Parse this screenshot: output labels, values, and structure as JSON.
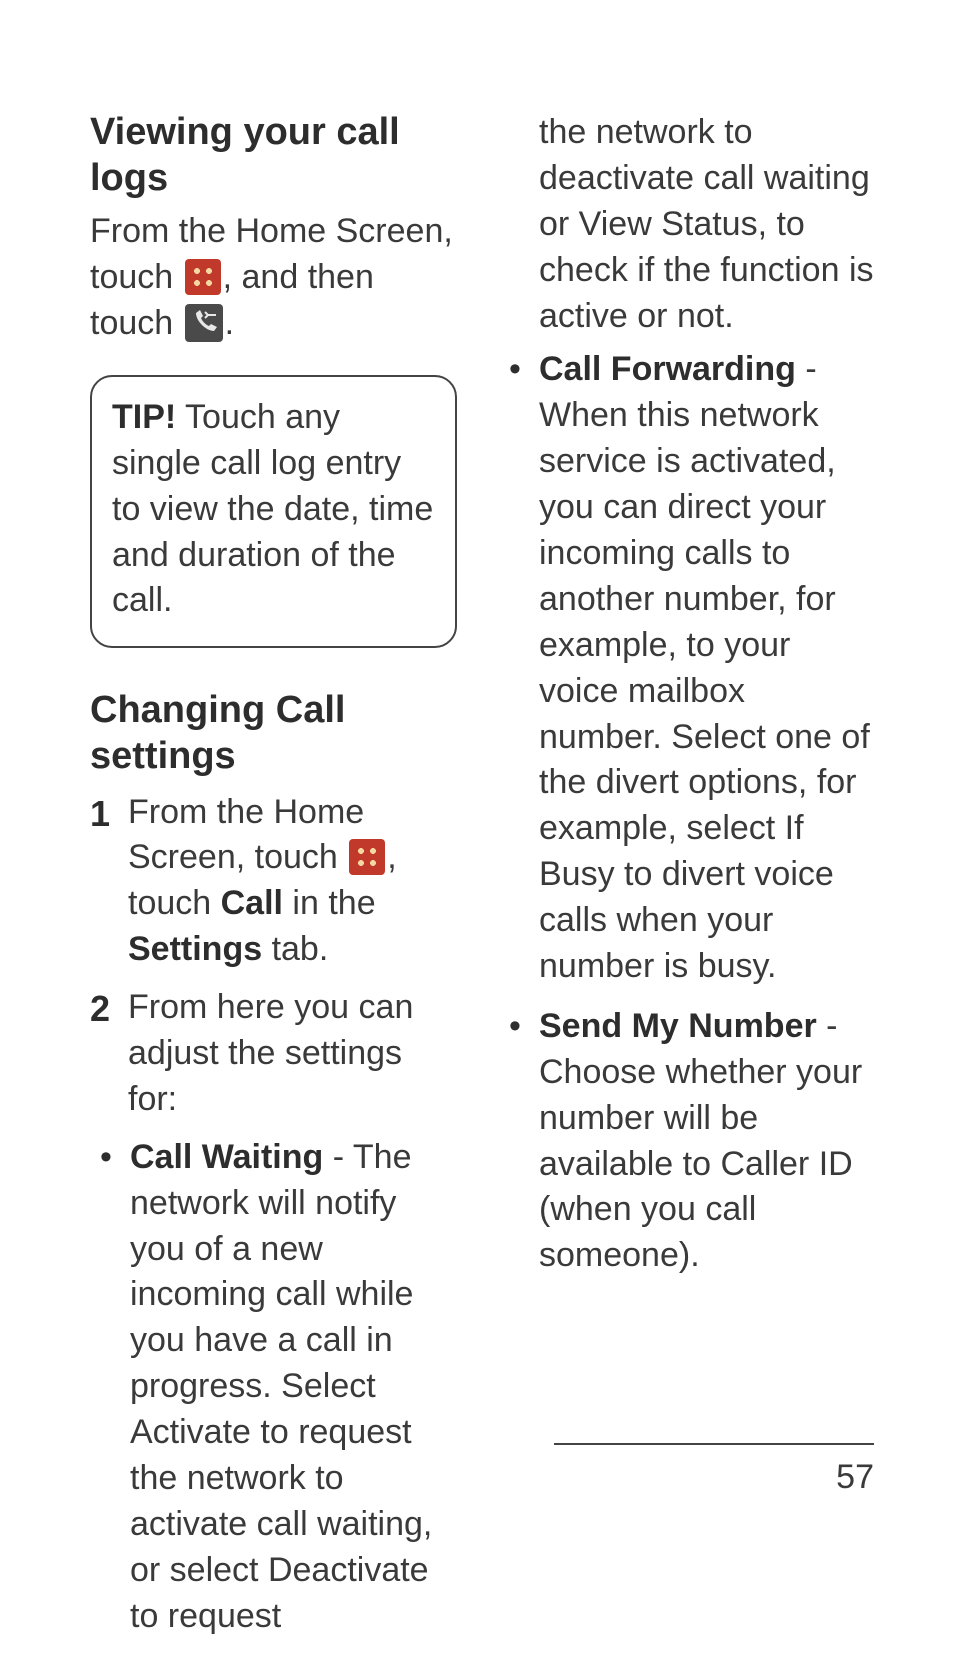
{
  "col1": {
    "h1": "Viewing your call logs",
    "p1a": "From the Home Screen, touch ",
    "p1b": ", and then touch ",
    "p1c": ".",
    "tip_label": "TIP!",
    "tip_body": " Touch any single call log entry to view the date, time and duration of the call.",
    "h2": "Changing Call settings",
    "step1a": "From the Home Screen, touch ",
    "step1b": ", touch ",
    "step1_call": "Call",
    "step1c": " in the ",
    "step1_settings": "Settings",
    "step1d": " tab.",
    "step2": "From here you can adjust the settings for:",
    "bullet1_label": "Call Waiting",
    "bullet1_body": " - The network will notify you of a new incoming call while you have a call in progress. Select Activate to request the network to activate call waiting, or select Deactivate to request"
  },
  "col2": {
    "carry": "the network to deactivate call waiting or View Status, to check if the function is active or not.",
    "b2_label": "Call Forwarding",
    "b2_body": " - When this network service is activated, you can direct your incoming calls to another number, for example, to your voice mailbox number. Select one of the divert options, for example, select If Busy to divert voice calls when your number is busy.",
    "b3_label": "Send My Number",
    "b3_body": " - Choose whether your number will be available to Caller ID (when you call someone)."
  },
  "page_number": "57"
}
